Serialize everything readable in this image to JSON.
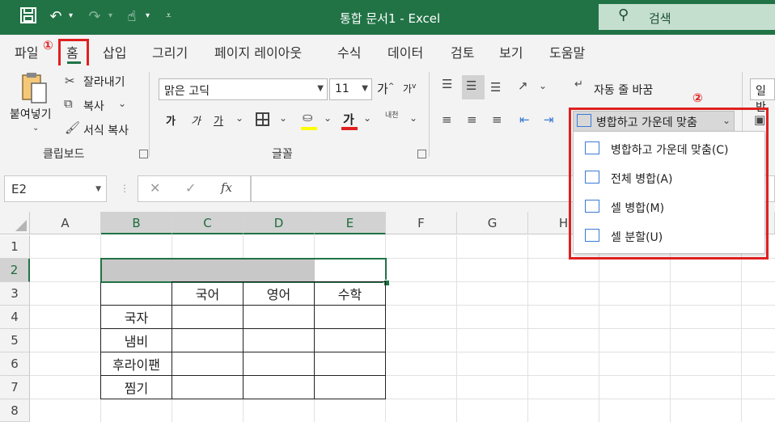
{
  "titlebar": {
    "title": "통합 문서1  -  Excel",
    "search_placeholder": "검색",
    "save_icon": "save-icon",
    "undo_icon": "undo-icon",
    "redo_icon": "redo-icon",
    "touch_icon": "touch-mode-icon",
    "customize_icon": "customize-qat-icon"
  },
  "tabs": [
    "파일",
    "홈",
    "삽입",
    "그리기",
    "페이지 레이아웃",
    "수식",
    "데이터",
    "검토",
    "보기",
    "도움말"
  ],
  "active_tab": "홈",
  "annotations": {
    "marker1": "①",
    "marker2": "②"
  },
  "ribbon": {
    "clipboard": {
      "paste_label": "붙여넣기",
      "cut_label": "잘라내기",
      "copy_label": "복사",
      "format_painter_label": "서식 복사",
      "group_name": "클립보드"
    },
    "font": {
      "font_name": "맑은 고딕",
      "font_size": "11",
      "grow_label": "가",
      "shrink_label": "가",
      "bold_label": "가",
      "italic_label": "가",
      "underline_label": "가",
      "font_color_label": "가",
      "phonetic_label": "내천",
      "group_name": "글꼴"
    },
    "alignment": {
      "wrap_text_label": "자동 줄 바꿈",
      "merge_center_label": "병합하고 가운데 맞춤"
    },
    "number": {
      "format_label": "일반"
    }
  },
  "merge_menu": {
    "items": [
      {
        "label": "병합하고 가운데 맞춤(C)",
        "icon": "merge-center-icon"
      },
      {
        "label": "전체 병합(A)",
        "icon": "merge-across-icon"
      },
      {
        "label": "셀 병합(M)",
        "icon": "merge-cells-icon"
      },
      {
        "label": "셀 분할(U)",
        "icon": "unmerge-cells-icon"
      }
    ]
  },
  "formula_bar": {
    "name_box": "E2",
    "cancel_icon": "✕",
    "enter_icon": "✓",
    "fx_label": "fx",
    "formula": ""
  },
  "sheet": {
    "columns": [
      "A",
      "B",
      "C",
      "D",
      "E",
      "F",
      "G",
      "H"
    ],
    "rows": [
      "1",
      "2",
      "3",
      "4",
      "5",
      "6",
      "7",
      "8"
    ],
    "selected_range": "B2:E2",
    "headers": [
      "국어",
      "영어",
      "수학"
    ],
    "row_labels": [
      "국자",
      "냄비",
      "후라이팬",
      "찜기"
    ]
  }
}
